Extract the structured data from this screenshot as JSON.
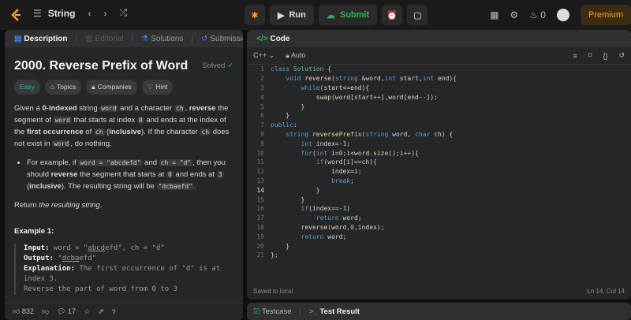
{
  "topbar": {
    "problem_list_label": "String",
    "run_label": "Run",
    "submit_label": "Submit",
    "streak_count": "0",
    "premium_label": "Premium"
  },
  "left": {
    "tabs": [
      {
        "label": "Description",
        "icon": "description-icon"
      },
      {
        "label": "Editorial",
        "icon": "editorial-icon"
      },
      {
        "label": "Solutions",
        "icon": "solutions-icon"
      },
      {
        "label": "Submissions",
        "icon": "submissions-icon"
      }
    ],
    "title": "2000. Reverse Prefix of Word",
    "solved_label": "Solved",
    "badges": [
      "Easy",
      "Topics",
      "Companies",
      "Hint"
    ],
    "desc": {
      "p1_a": "Given a ",
      "p1_b": "0-indexed",
      "p1_c": " string ",
      "p1_word": "word",
      "p1_d": " and a character ",
      "p1_ch": "ch",
      "p1_e": ", ",
      "p1_rev": "reverse",
      "p1_f": " the segment of ",
      "p1_word2": "word",
      "p1_g": " that starts at index ",
      "p1_zero": "0",
      "p1_h": " and ends at the index of the ",
      "p1_first": "first occurrence",
      "p1_i": " of ",
      "p1_ch2": "ch",
      "p1_j": " (",
      "p1_incl": "inclusive",
      "p1_k": "). If the character ",
      "p1_ch3": "ch",
      "p1_l": " does not exist in ",
      "p1_word3": "word",
      "p1_m": ", do nothing.",
      "b1_a": "For example, if ",
      "b1_word": "word = \"abcdefd\"",
      "b1_b": " and ",
      "b1_ch": "ch = \"d\"",
      "b1_c": ", then you should ",
      "b1_rev": "reverse",
      "b1_d": " the segment that starts at ",
      "b1_zero": "0",
      "b1_e": " and ends at ",
      "b1_three": "3",
      "b1_f": " (",
      "b1_incl": "inclusive",
      "b1_g": "). The resulting string will be ",
      "b1_res": "\"dcbaefd\"",
      "b1_h": ".",
      "ret_a": "Return ",
      "ret_b": "the resulting string",
      "ret_c": "."
    },
    "example_heading": "Example 1:",
    "example": {
      "input_label": "Input:",
      "input_a": " word = \"",
      "input_u": "abcd",
      "input_b": "efd\", ch = \"d\"",
      "output_label": "Output:",
      "output_a": " \"",
      "output_u": "dcba",
      "output_b": "efd\"",
      "expl_label": "Explanation:",
      "expl_text": " The first occurrence of \"d\" is at index 3.",
      "expl_more": "Reverse the part of word from 0 to 3"
    },
    "footer": {
      "likes": "832",
      "comments": "17"
    }
  },
  "right": {
    "tab_label": "Code",
    "language": "C++",
    "auto_label": "Auto",
    "status_left": "Saved to local",
    "status_right": "Ln 14, Col 14",
    "current_line": 14
  },
  "bottom": {
    "testcase_label": "Testcase",
    "result_label": "Test Result"
  }
}
